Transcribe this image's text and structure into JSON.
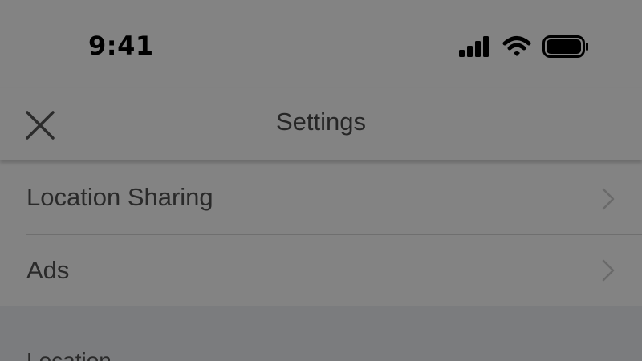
{
  "status_bar": {
    "time": "9:41",
    "icons": [
      "cellular-signal-icon",
      "wifi-icon",
      "battery-icon"
    ]
  },
  "header": {
    "title": "Settings",
    "close_icon": "close-icon"
  },
  "list": {
    "items": [
      {
        "label": "Location Sharing",
        "icon": "chevron-right-icon"
      },
      {
        "label": "Ads",
        "icon": "chevron-right-icon"
      }
    ]
  },
  "section": {
    "header": "Location"
  }
}
